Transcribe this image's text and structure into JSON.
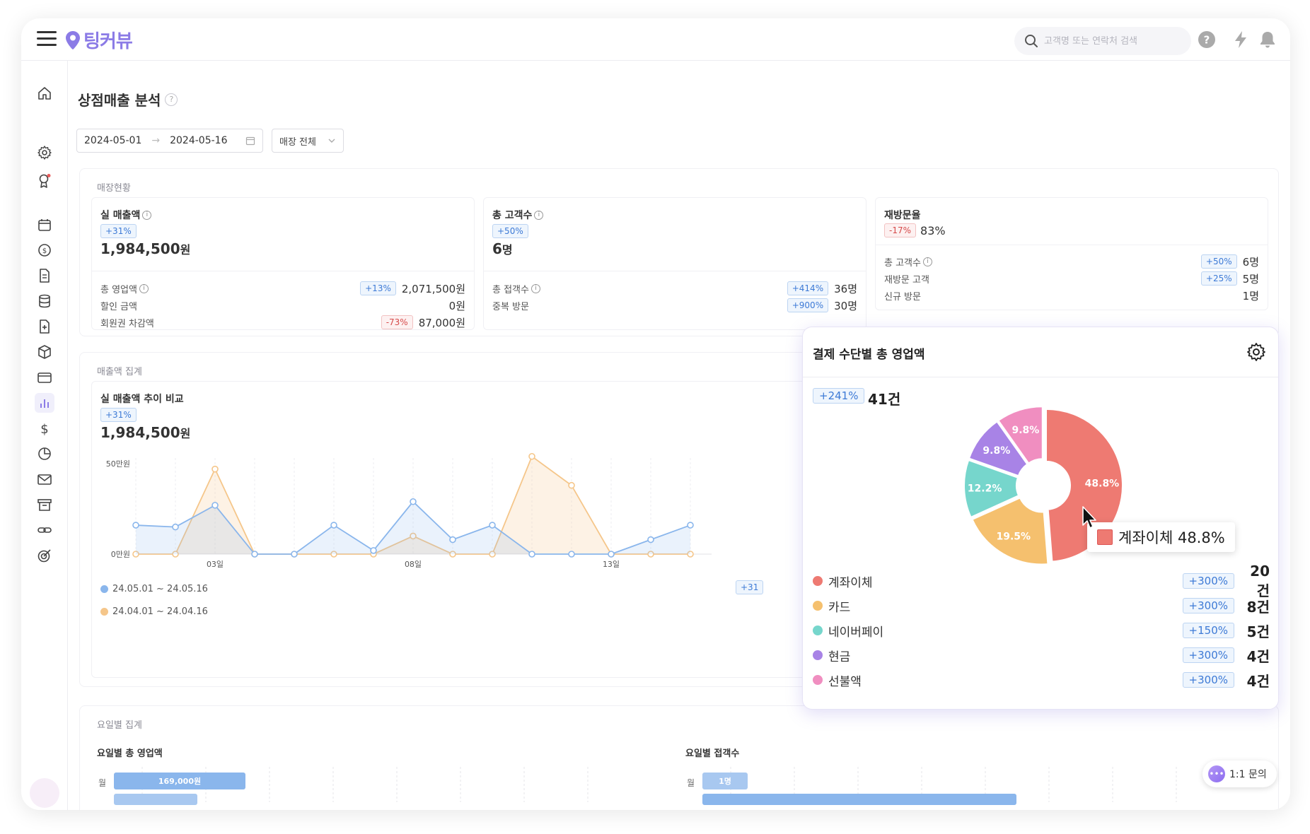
{
  "app": {
    "logo_text": "팅커뷰",
    "search_placeholder": "고객명 또는 연락처 검색"
  },
  "page": {
    "title": "상점매출 분석",
    "date_start": "2024-05-01",
    "date_arrow": "→",
    "date_end": "2024-05-16",
    "store_select": "매장 전체"
  },
  "status": {
    "label": "매장현황",
    "card_sales": {
      "title": "실 매출액",
      "badge": "+31%",
      "value": "1,984,500",
      "unit": "원",
      "rows": [
        {
          "label": "총 영업액",
          "badge": "+13%",
          "value": "2,071,500원"
        },
        {
          "label": "할인 금액",
          "badge": "",
          "value": "0원"
        },
        {
          "label": "회원권 차감액",
          "badge": "-73%",
          "value": "87,000원"
        }
      ]
    },
    "card_customers": {
      "title": "총 고객수",
      "badge": "+50%",
      "value": "6",
      "unit": "명",
      "rows": [
        {
          "label": "총 접객수",
          "badge": "+414%",
          "value": "36명"
        },
        {
          "label": "중복 방문",
          "badge": "+900%",
          "value": "30명"
        }
      ]
    },
    "card_revisit": {
      "title": "재방문율",
      "badge": "-17%",
      "value": "83%",
      "rows": [
        {
          "label": "총 고객수",
          "badge": "+50%",
          "value": "6명"
        },
        {
          "label": "재방문 고객",
          "badge": "+25%",
          "value": "5명"
        },
        {
          "label": "신규 방문",
          "badge": "",
          "value": "1명"
        }
      ]
    }
  },
  "sales_agg": {
    "label": "매출액 집계",
    "trend_title": "실 매출액 추이 비교",
    "trend_badge": "+31%",
    "trend_value": "1,984,500",
    "trend_unit": "원",
    "hidden_badge": "+31",
    "legend": [
      {
        "label": "24.05.01 ~ 24.05.16",
        "color": "#8ab6ec"
      },
      {
        "label": "24.04.01 ~ 24.04.16",
        "color": "#f5c68a"
      }
    ]
  },
  "chart_data": [
    {
      "type": "line",
      "title": "실 매출액 추이 비교",
      "y_tick_labels": [
        "50만원",
        "0만원"
      ],
      "x_tick_labels": [
        "03일",
        "08일",
        "13일"
      ],
      "ylim": [
        0,
        50
      ],
      "x": [
        1,
        2,
        3,
        4,
        5,
        6,
        7,
        8,
        9,
        10,
        11,
        12,
        13,
        14,
        15
      ],
      "series": [
        {
          "name": "24.05.01 ~ 24.05.16",
          "color": "#8ab6ec",
          "values": [
            16,
            15,
            27,
            0,
            0,
            16,
            2,
            29,
            8,
            16,
            0,
            0,
            0,
            8,
            16
          ]
        },
        {
          "name": "24.04.01 ~ 24.04.16",
          "color": "#f5c68a",
          "values": [
            0,
            0,
            47,
            0,
            0,
            0,
            0,
            10,
            0,
            0,
            54,
            38,
            0,
            0,
            0
          ]
        }
      ],
      "area": true,
      "grid": true
    },
    {
      "type": "pie",
      "title": "결제 수단별 총 영업액",
      "slices": [
        {
          "label": "계좌이체",
          "value": 48.8,
          "color": "#ee7a72"
        },
        {
          "label": "카드",
          "value": 19.5,
          "color": "#f5c06e"
        },
        {
          "label": "네이버페이",
          "value": 12.2,
          "color": "#76d6cc"
        },
        {
          "label": "현금",
          "value": 9.8,
          "color": "#a883e6"
        },
        {
          "label": "선불액",
          "value": 9.8,
          "color": "#f08ec0"
        }
      ],
      "donut": true
    },
    {
      "type": "bar",
      "title": "요일별 총 영업액",
      "categories": [
        "월"
      ],
      "values": [
        169000
      ],
      "value_labels": [
        "169,000원"
      ],
      "ylim": [
        0,
        169000
      ]
    },
    {
      "type": "bar",
      "title": "요일별 접객수",
      "categories": [
        "월"
      ],
      "values": [
        1
      ],
      "value_labels": [
        "1명"
      ],
      "ylim": [
        0,
        1
      ]
    }
  ],
  "popup": {
    "title": "결제 수단별 총 영업액",
    "badge": "+241%",
    "count": "41건",
    "tooltip": "계좌이체 48.8%",
    "rows": [
      {
        "name": "계좌이체",
        "color": "#ee7a72",
        "badge": "+300%",
        "count": "20건"
      },
      {
        "name": "카드",
        "color": "#f5c06e",
        "badge": "+300%",
        "count": "8건"
      },
      {
        "name": "네이버페이",
        "color": "#76d6cc",
        "badge": "+150%",
        "count": "5건"
      },
      {
        "name": "현금",
        "color": "#a883e6",
        "badge": "+300%",
        "count": "4건"
      },
      {
        "name": "선불액",
        "color": "#f08ec0",
        "badge": "+300%",
        "count": "4건"
      }
    ]
  },
  "weekday": {
    "label": "요일별 집계",
    "sales_title": "요일별 총 영업액",
    "visits_title": "요일별 접객수",
    "row_label": "월",
    "sales_bar": "169,000원",
    "visits_bar": "1명"
  },
  "inquiry": {
    "label": "1:1 문의"
  },
  "colors": {
    "accent": "#8b7be6",
    "blue": "#8ab6ec",
    "orange": "#f5c68a"
  }
}
